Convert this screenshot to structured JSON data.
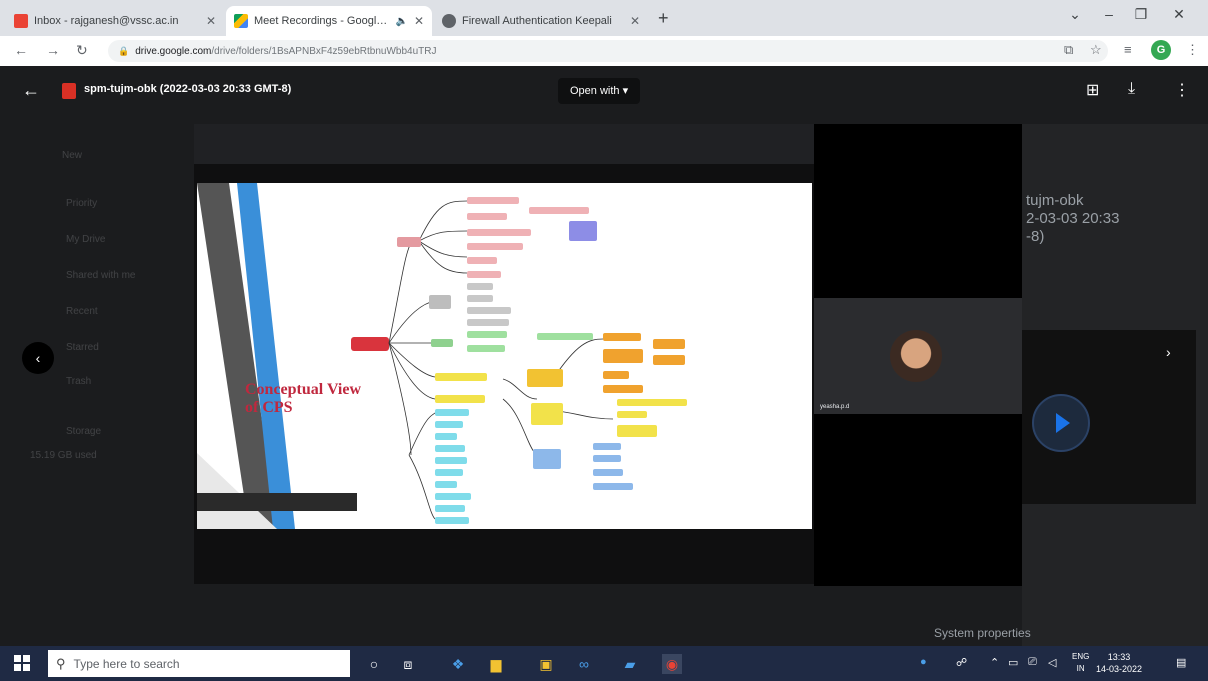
{
  "browser": {
    "tabs": [
      {
        "title": "Inbox - rajganesh@vssc.ac.in",
        "favicon_color": "#ea4335",
        "active": false
      },
      {
        "title": "Meet Recordings - Google D",
        "favicon_color": "#fbbc04",
        "active": true
      },
      {
        "title": "Firewall Authentication Keepali",
        "favicon_color": "#5f6368",
        "active": false
      }
    ],
    "new_tab": "+",
    "url_domain": "drive.google.com",
    "url_path": "/drive/folders/1BsAPNBxF4z59ebRtbnuWbb4uTRJ",
    "profile_initial": "G"
  },
  "viewer": {
    "file_title": "spm-tujm-obk (2022-03-03 20:33 GMT-8)",
    "open_with_label": "Open with",
    "slide_title_line1": "Conceptual View",
    "slide_title_line2": "of CPS",
    "participant_name": "yeasha.p.d",
    "details_title_line1": "tujm-obk",
    "details_title_line2": "2-03-03 20:33",
    "details_title_line3": "-8)",
    "details_section": "System properties",
    "background_sidebar": [
      "New",
      "Priority",
      "My Drive",
      "Shared with me",
      "Recent",
      "Starred",
      "Trash",
      "Storage",
      "15.19 GB used"
    ]
  },
  "taskbar": {
    "search_placeholder": "Type here to search",
    "language_line1": "ENG",
    "language_line2": "IN",
    "time": "13:33",
    "date": "14-03-2022"
  },
  "colors": {
    "accent_blue": "#1a73e8",
    "slide_title": "#c0283e",
    "taskbar": "#1f2a44"
  }
}
